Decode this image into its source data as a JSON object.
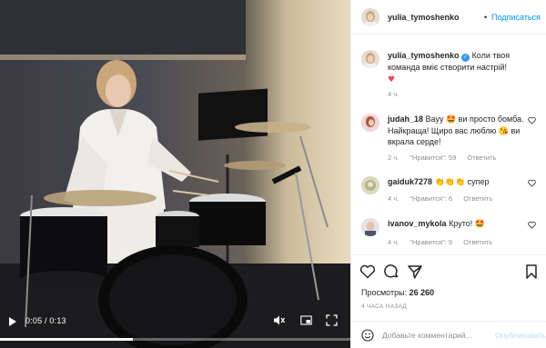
{
  "post": {
    "username": "yulia_tymoshenko",
    "follow_label": "Подписаться",
    "dot": "•",
    "caption_username": "yulia_tymoshenko",
    "caption_text": "Коли твоя команда вміє створити настрій!",
    "caption_time": "4 ч."
  },
  "video": {
    "timecode": "0:05 / 0:13",
    "progress": 0.38
  },
  "comments": [
    {
      "username": "judah_18",
      "text": "Вауу 🤩 ви просто бомба. Найкраща! Щиро вас люблю 😘 ви вкрала серде!",
      "time": "2 ч.",
      "likes": "\"Нравится\": 59",
      "reply": "Ответить"
    },
    {
      "username": "gaiduk7278",
      "text": "👏👏👏 супер",
      "time": "4 ч.",
      "likes": "\"Нравится\": 6",
      "reply": "Ответить"
    },
    {
      "username": "ivanov_mykola",
      "text": "Круто! 🤩",
      "time": "4 ч.",
      "likes": "\"Нравится\": 9",
      "reply": "Ответить"
    }
  ],
  "stats": {
    "views_label": "Просмотры:",
    "views_value": "26 260",
    "age": "4 ЧАСА НАЗАД"
  },
  "composer": {
    "placeholder": "Добавьте комментарий...",
    "publish_label": "Опубликовать"
  },
  "colors": {
    "accent": "#0095f6",
    "heart": "#ed4956",
    "muted": "#8e8e8e"
  },
  "icons": [
    "play-icon",
    "mute-icon",
    "pip-icon",
    "fullscreen-icon",
    "heart-icon",
    "comment-icon",
    "share-icon",
    "bookmark-icon",
    "smile-icon",
    "verified-icon"
  ]
}
